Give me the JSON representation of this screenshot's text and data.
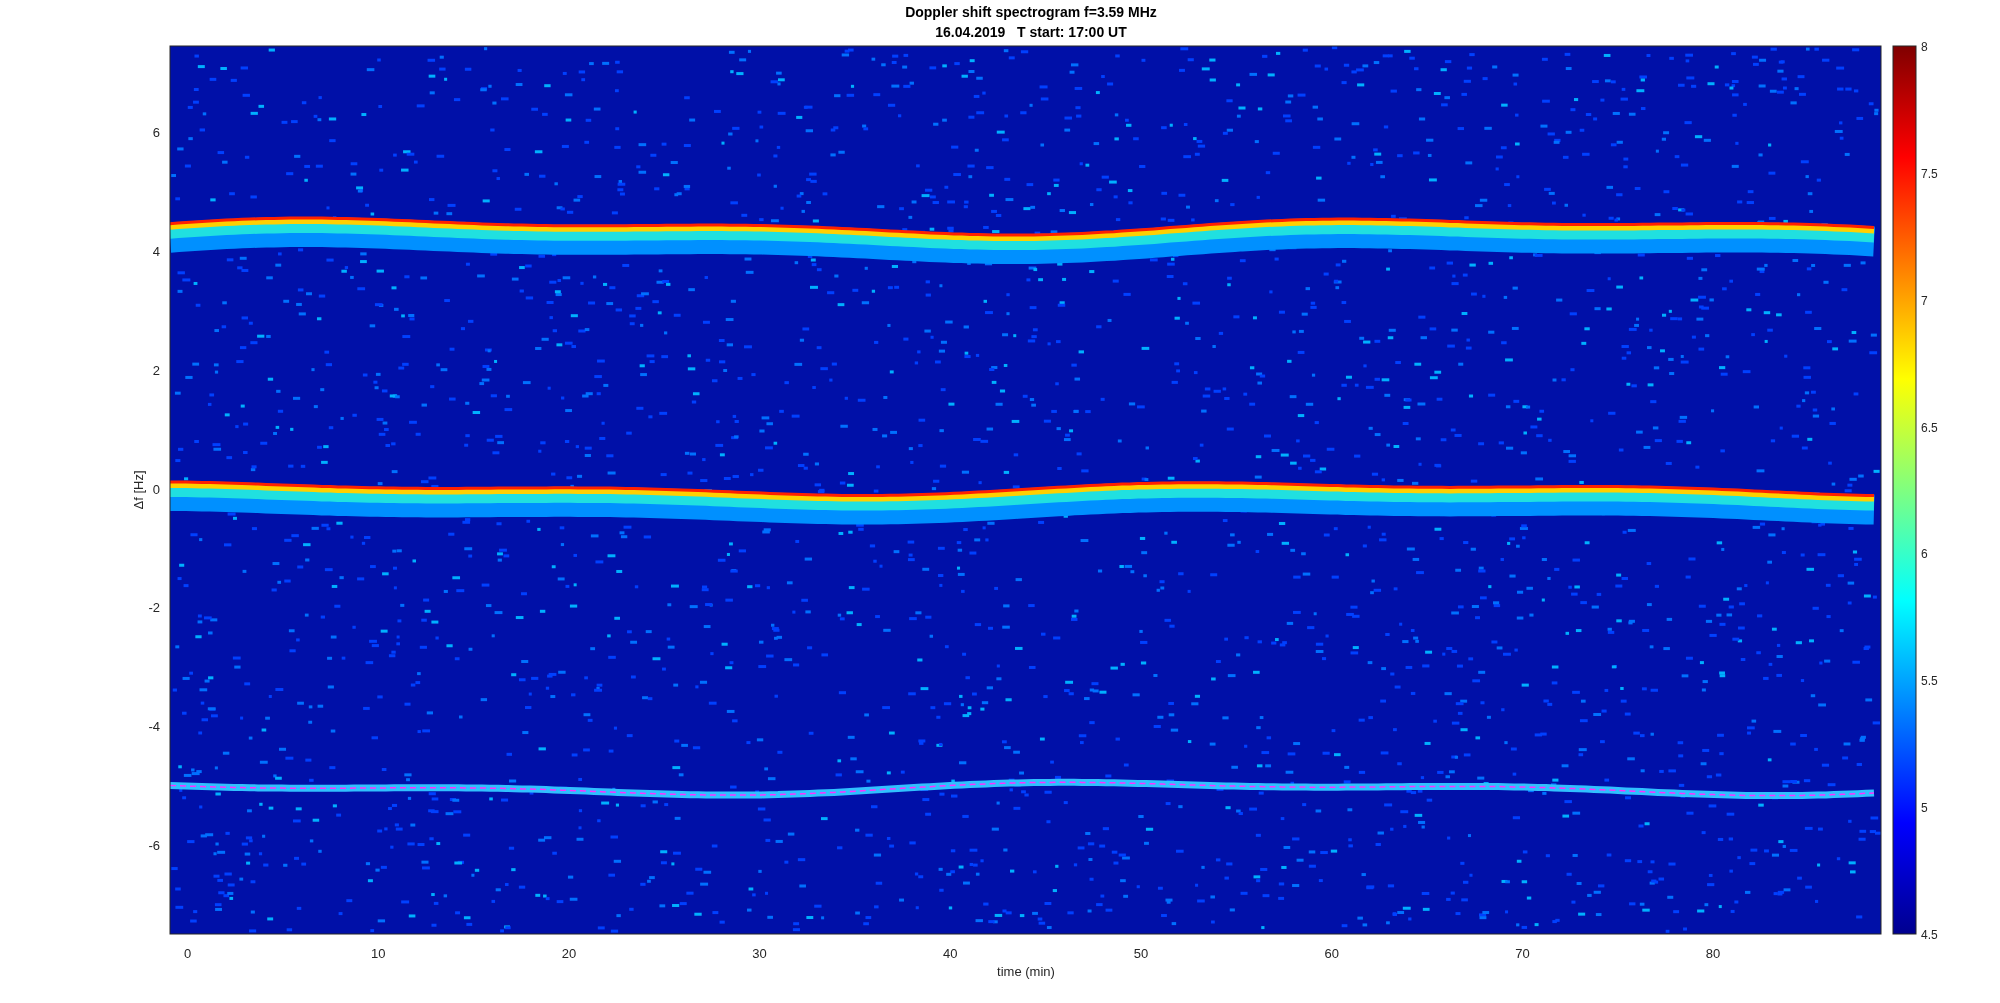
{
  "title": [
    "Doppler shift spectrogram f=3.59 MHz",
    "16.04.2019   T start: 17:00 UT"
  ],
  "x_axis": {
    "label": "time (min)",
    "ticks": [
      "0",
      "10",
      "20",
      "30",
      "40",
      "50",
      "60",
      "70",
      "80"
    ]
  },
  "y_axis": {
    "label": "Δf [Hz]",
    "ticks": [
      "6",
      "4",
      "2",
      "0",
      "-2",
      "-4",
      "-6"
    ]
  },
  "colorbar": {
    "ticks": [
      "8",
      "7.5",
      "7",
      "6.5",
      "6",
      "5.5",
      "5",
      "4.5"
    ]
  }
}
